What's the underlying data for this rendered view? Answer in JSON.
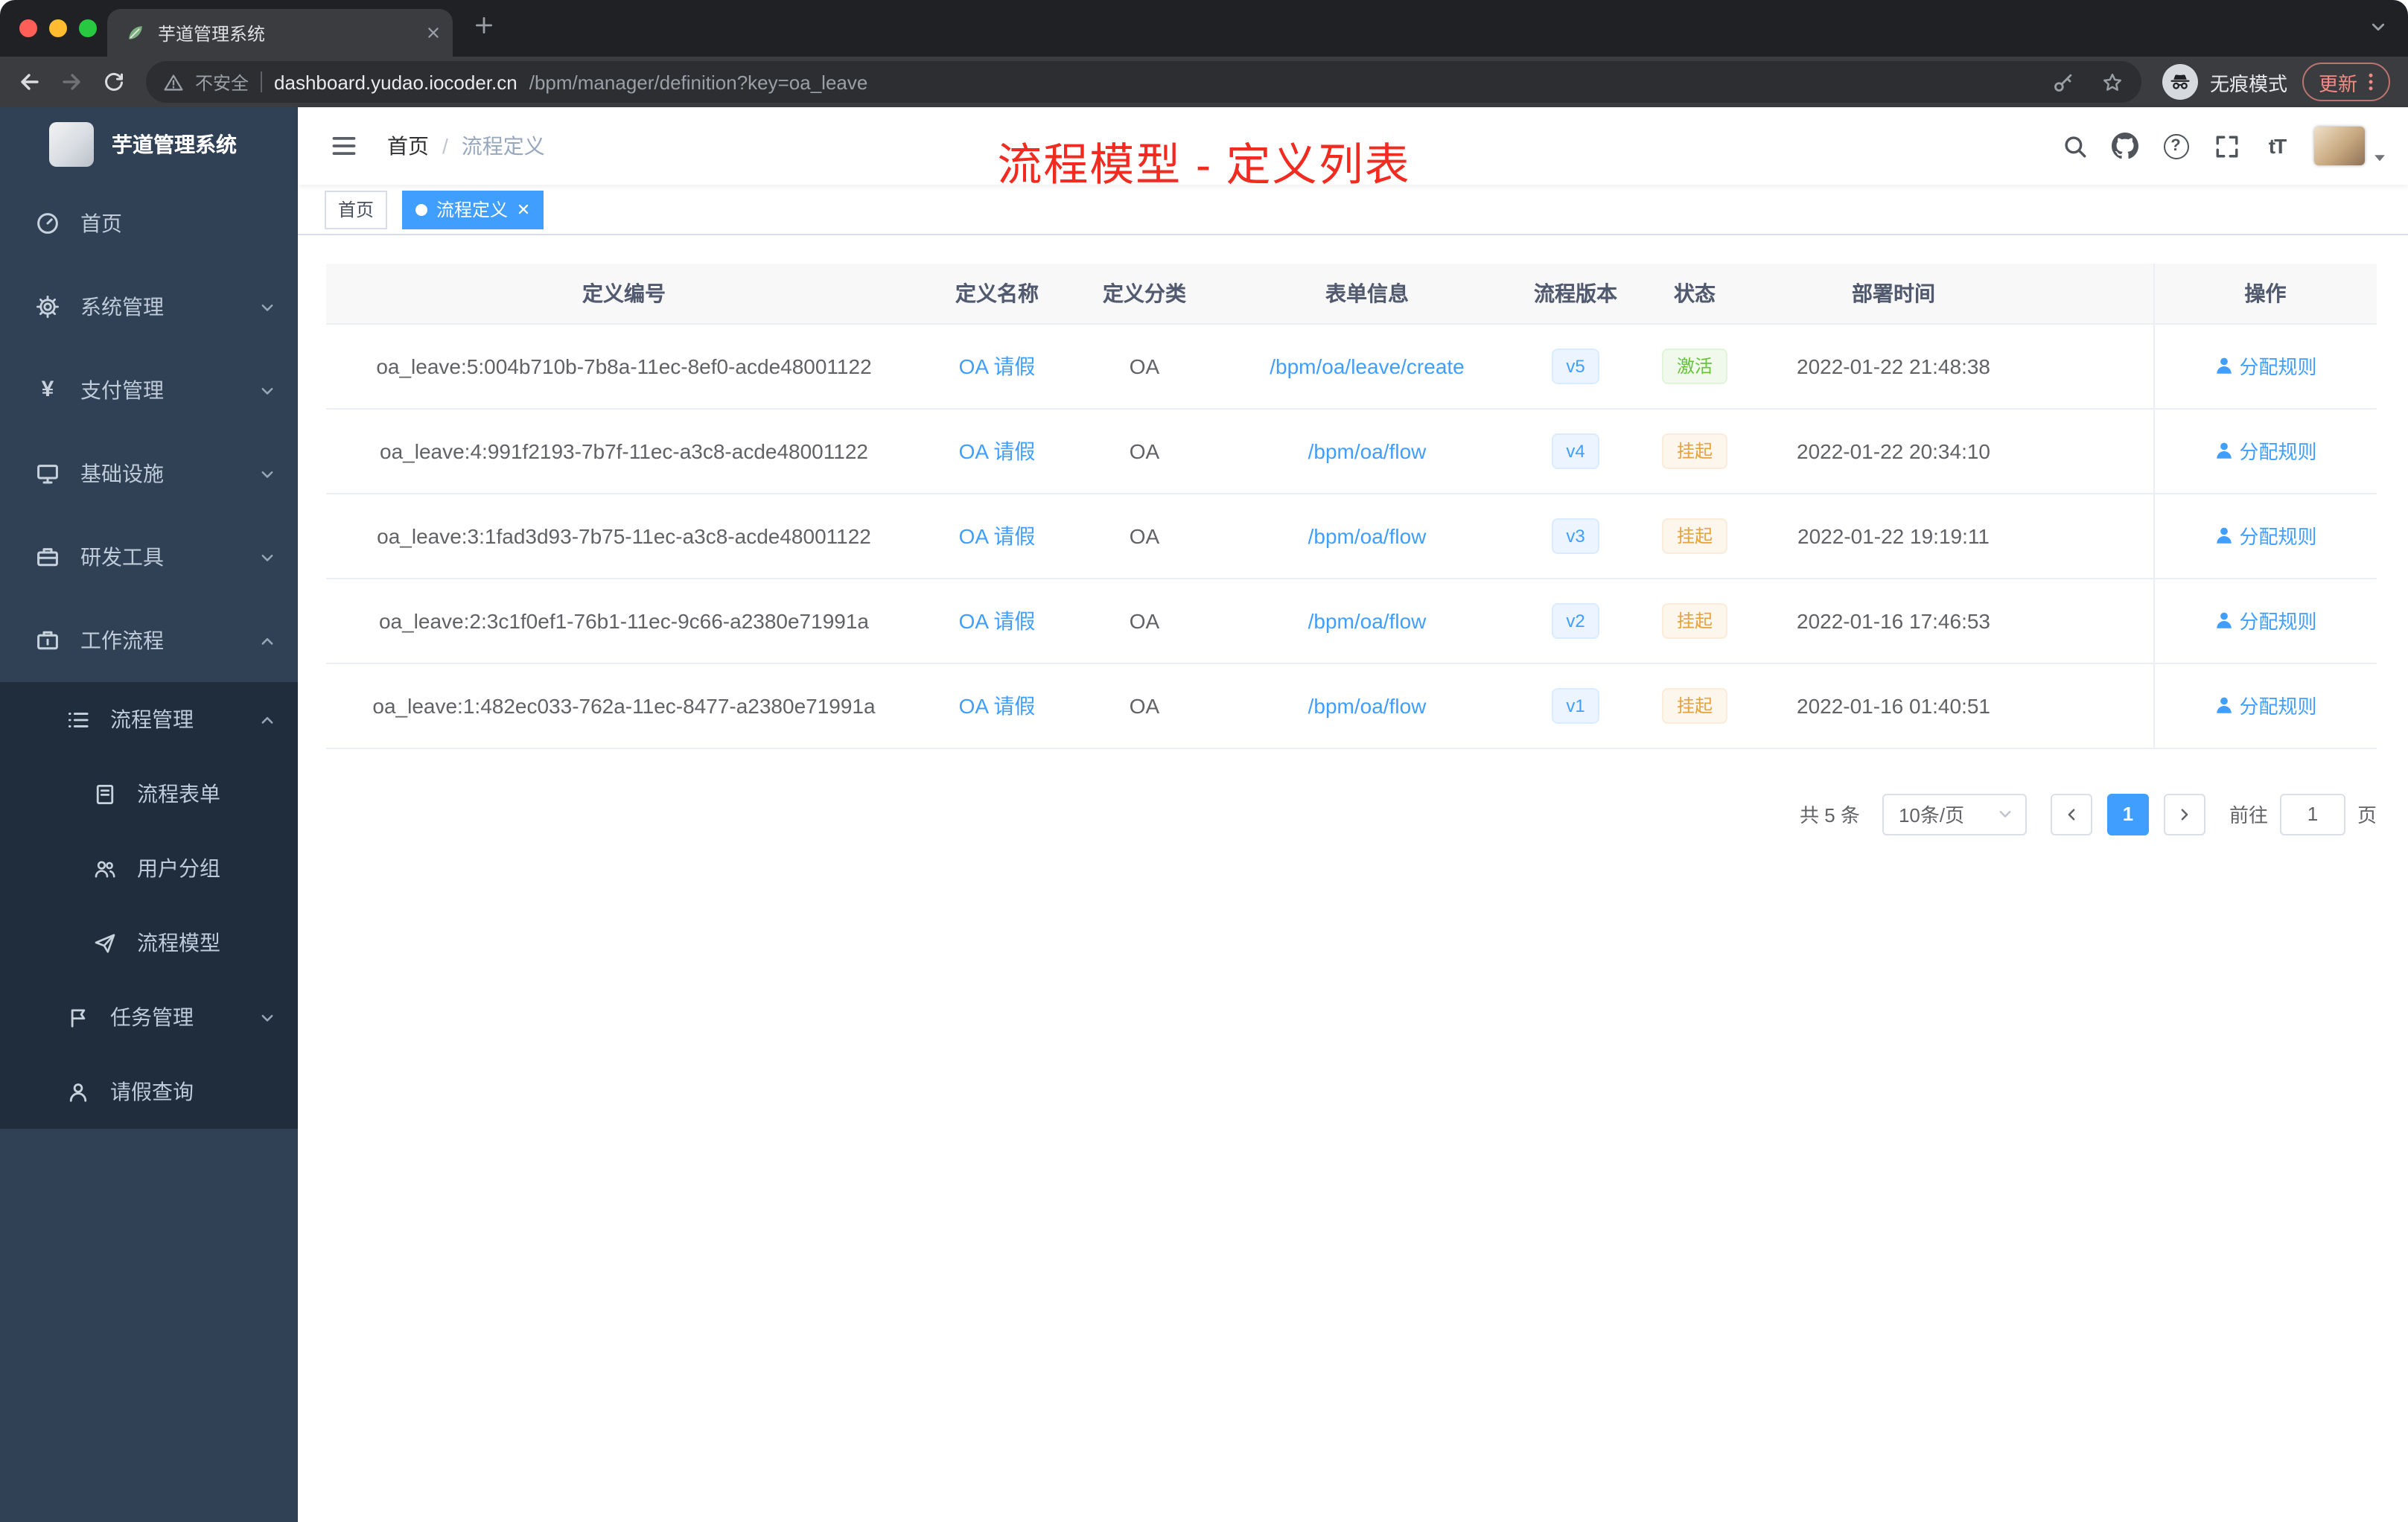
{
  "browser": {
    "tab_title": "芋道管理系统",
    "security_label": "不安全",
    "url_host": "dashboard.yudao.iocoder.cn",
    "url_path": "/bpm/manager/definition?key=oa_leave",
    "incognito_label": "无痕模式",
    "update_label": "更新"
  },
  "sidebar": {
    "app_title": "芋道管理系统",
    "items": [
      {
        "label": "首页"
      },
      {
        "label": "系统管理"
      },
      {
        "label": "支付管理"
      },
      {
        "label": "基础设施"
      },
      {
        "label": "研发工具"
      },
      {
        "label": "工作流程"
      }
    ],
    "submenu": {
      "process": {
        "label": "流程管理"
      },
      "process_children": [
        {
          "label": "流程表单"
        },
        {
          "label": "用户分组"
        },
        {
          "label": "流程模型"
        }
      ],
      "task": {
        "label": "任务管理"
      },
      "leave": {
        "label": "请假查询"
      }
    }
  },
  "navbar": {
    "breadcrumb_home": "首页",
    "breadcrumb_separator": "/",
    "breadcrumb_current": "流程定义"
  },
  "annotation": "流程模型 - 定义列表",
  "tags_view": {
    "home": "首页",
    "active": "流程定义"
  },
  "icons": {
    "yen_glyph": "¥",
    "help_glyph": "?",
    "font_size_glyph": "tT"
  },
  "table": {
    "headers": {
      "id": "定义编号",
      "name": "定义名称",
      "category": "定义分类",
      "form": "表单信息",
      "version": "流程版本",
      "status": "状态",
      "deploy_time": "部署时间",
      "action": "操作"
    },
    "rows": [
      {
        "id": "oa_leave:5:004b710b-7b8a-11ec-8ef0-acde48001122",
        "name": "OA 请假",
        "category": "OA",
        "form": "/bpm/oa/leave/create",
        "version": "v5",
        "status": "激活",
        "status_type": "success",
        "deploy_time": "2022-01-22 21:48:38",
        "action": "分配规则"
      },
      {
        "id": "oa_leave:4:991f2193-7b7f-11ec-a3c8-acde48001122",
        "name": "OA 请假",
        "category": "OA",
        "form": "/bpm/oa/flow",
        "version": "v4",
        "status": "挂起",
        "status_type": "warning",
        "deploy_time": "2022-01-22 20:34:10",
        "action": "分配规则"
      },
      {
        "id": "oa_leave:3:1fad3d93-7b75-11ec-a3c8-acde48001122",
        "name": "OA 请假",
        "category": "OA",
        "form": "/bpm/oa/flow",
        "version": "v3",
        "status": "挂起",
        "status_type": "warning",
        "deploy_time": "2022-01-22 19:19:11",
        "action": "分配规则"
      },
      {
        "id": "oa_leave:2:3c1f0ef1-76b1-11ec-9c66-a2380e71991a",
        "name": "OA 请假",
        "category": "OA",
        "form": "/bpm/oa/flow",
        "version": "v2",
        "status": "挂起",
        "status_type": "warning",
        "deploy_time": "2022-01-16 17:46:53",
        "action": "分配规则"
      },
      {
        "id": "oa_leave:1:482ec033-762a-11ec-8477-a2380e71991a",
        "name": "OA 请假",
        "category": "OA",
        "form": "/bpm/oa/flow",
        "version": "v1",
        "status": "挂起",
        "status_type": "warning",
        "deploy_time": "2022-01-16 01:40:51",
        "action": "分配规则"
      }
    ]
  },
  "pagination": {
    "total": "共 5 条",
    "page_size": "10条/页",
    "current_page": "1",
    "goto_label": "前往",
    "goto_value": "1",
    "unit_label": "页"
  },
  "colors": {
    "primary": "#409eff",
    "success": "#67c23a",
    "warning": "#e6a23c",
    "annotation_red": "#f12b20",
    "sidebar_bg": "#304156",
    "submenu_bg": "#1f2d3d"
  }
}
